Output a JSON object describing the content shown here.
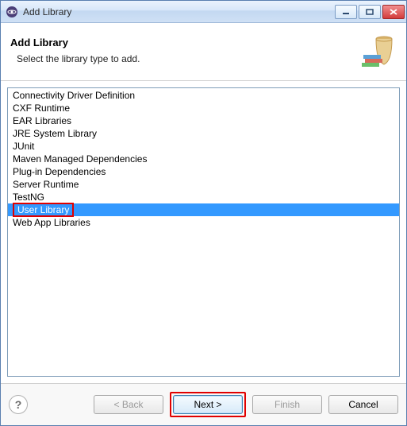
{
  "window": {
    "title": "Add Library"
  },
  "banner": {
    "title": "Add Library",
    "subtitle": "Select the library type to add."
  },
  "list": {
    "items": [
      "Connectivity Driver Definition",
      "CXF Runtime",
      "EAR Libraries",
      "JRE System Library",
      "JUnit",
      "Maven Managed Dependencies",
      "Plug-in Dependencies",
      "Server Runtime",
      "TestNG",
      "User Library",
      "Web App Libraries"
    ],
    "selected_index": 9
  },
  "buttons": {
    "back": "< Back",
    "next": "Next >",
    "finish": "Finish",
    "cancel": "Cancel"
  }
}
